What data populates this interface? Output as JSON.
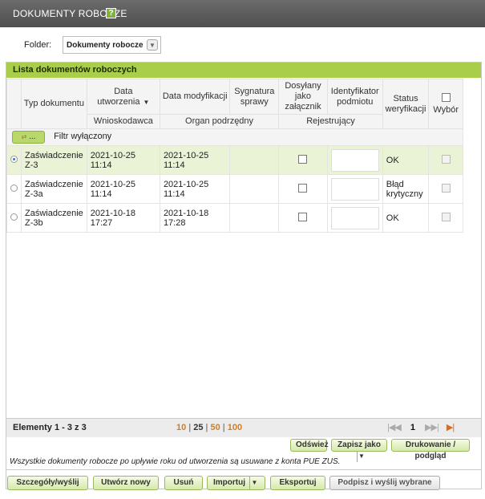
{
  "window": {
    "title": "DOKUMENTY ROBOCZE",
    "help_glyph": "?"
  },
  "folder": {
    "label": "Folder:",
    "value": "Dokumenty robocze"
  },
  "panel": {
    "title": "Lista dokumentów roboczych"
  },
  "columns": {
    "typ": "Typ dokumentu",
    "data_utw": "Data utworzenia",
    "data_mod": "Data modyfikacji",
    "sygnatura": "Sygnatura sprawy",
    "dosylany": "Dosyłany jako załącznik",
    "identyfikator": "Identyfikator podmiotu",
    "status": "Status weryfikacji",
    "wybor": "Wybór",
    "wnioskodawca": "Wnioskodawca",
    "organ": "Organ podrzędny",
    "rejestrujacy": "Rejestrujący"
  },
  "filter": {
    "button_label": "...",
    "text": "Filtr wyłączony"
  },
  "rows": [
    {
      "typ": "Zaświadczenie Z-3",
      "data_utw": "2021-10-25 11:14",
      "data_mod": "2021-10-25 11:14",
      "status": "OK"
    },
    {
      "typ": "Zaświadczenie Z-3a",
      "data_utw": "2021-10-25 11:14",
      "data_mod": "2021-10-25 11:14",
      "status": "Błąd krytyczny"
    },
    {
      "typ": "Zaświadczenie Z-3b",
      "data_utw": "2021-10-18 17:27",
      "data_mod": "2021-10-18 17:28",
      "status": "OK"
    }
  ],
  "pagination": {
    "elements": "Elementy 1 - 3 z 3",
    "sizes": [
      "10",
      "25",
      "50",
      "100"
    ],
    "current_page": "1"
  },
  "actions": {
    "odswiez": "Odśwież",
    "zapisz_jako": "Zapisz jako",
    "drukowanie": "Drukowanie / podgląd"
  },
  "note": "Wszystkie dokumenty robocze po upływie roku od utworzenia są usuwane z konta PUE ZUS.",
  "bottom_buttons": {
    "szczegoly": "Szczegóły/wyślij",
    "utworz": "Utwórz nowy",
    "usun": "Usuń",
    "importuj": "Importuj",
    "eksportuj": "Eksportuj",
    "podpisz": "Podpisz i wyślij wybrane"
  }
}
